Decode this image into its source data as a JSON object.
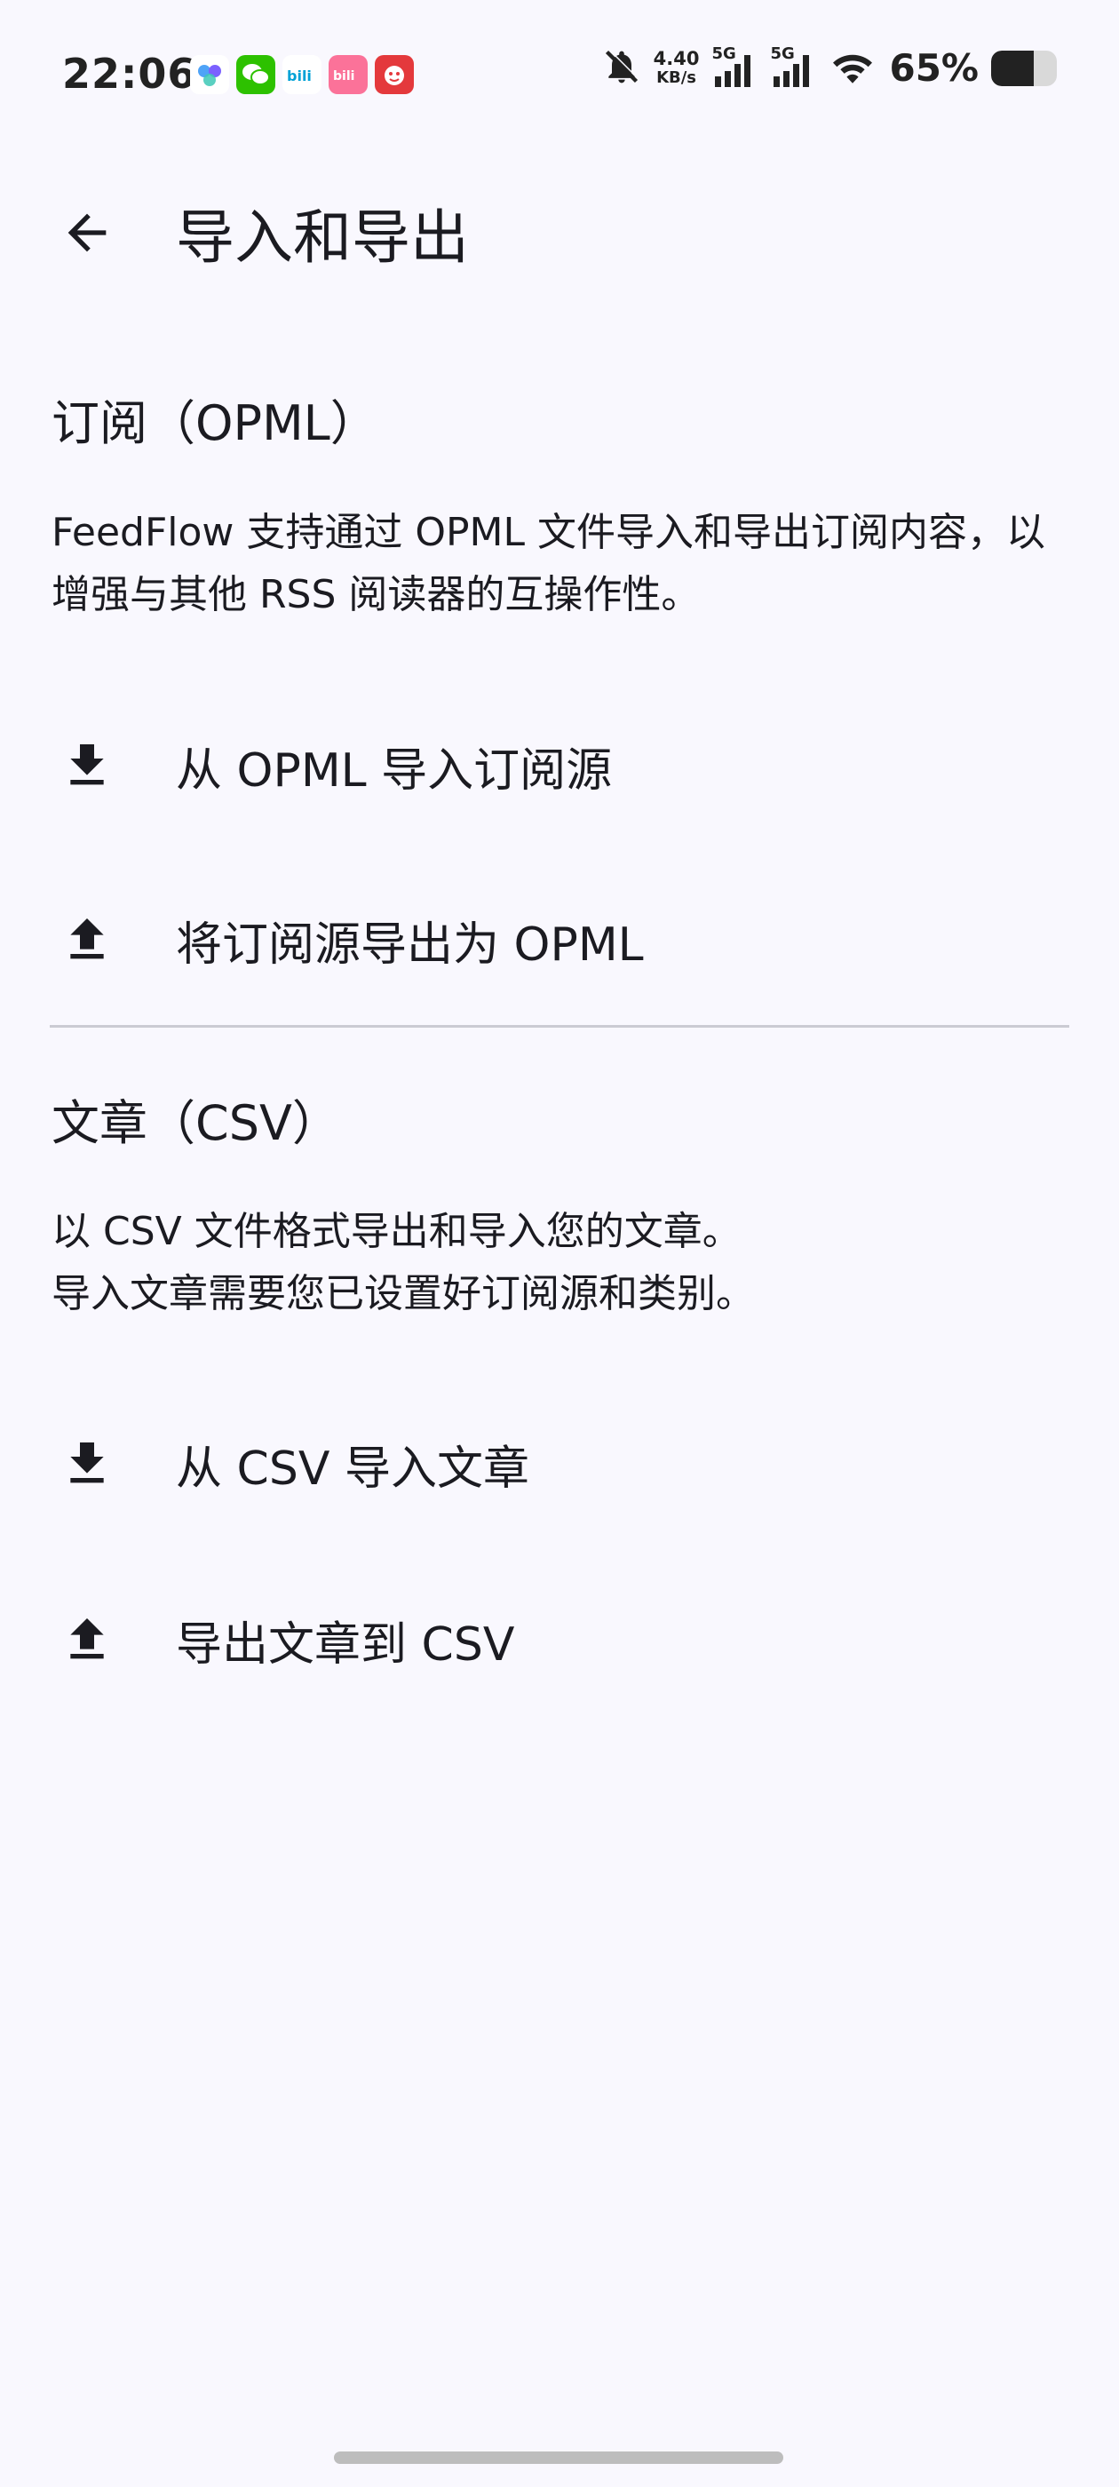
{
  "status_bar": {
    "time": "22:06",
    "net_speed_value": "4.40",
    "net_speed_unit": "KB/s",
    "signal1_label": "5G",
    "signal2_label": "5G",
    "battery_percent": "65%",
    "battery_level": 0.65,
    "icons": [
      "app-notification-icon",
      "wechat-icon",
      "bilibili-icon",
      "bilibili-pink-icon",
      "jd-icon",
      "bell-off-icon",
      "wifi-icon"
    ]
  },
  "app_bar": {
    "title": "导入和导出"
  },
  "sections": [
    {
      "title": "订阅（OPML）",
      "description": "FeedFlow 支持通过 OPML 文件导入和导出订阅内容，以增强与其他 RSS 阅读器的互操作性。",
      "actions": [
        {
          "label": "从 OPML 导入订阅源",
          "icon": "download-icon"
        },
        {
          "label": "将订阅源导出为 OPML",
          "icon": "upload-icon"
        }
      ]
    },
    {
      "title": "文章（CSV）",
      "description_line1": "以 CSV 文件格式导出和导入您的文章。",
      "description_line2": "导入文章需要您已设置好订阅源和类别。",
      "actions": [
        {
          "label": "从 CSV 导入文章",
          "icon": "download-icon"
        },
        {
          "label": "导出文章到 CSV",
          "icon": "upload-icon"
        }
      ]
    }
  ],
  "colors": {
    "background": "#F9F8FE",
    "text": "#1B1B21",
    "divider": "#CBCBD3"
  }
}
